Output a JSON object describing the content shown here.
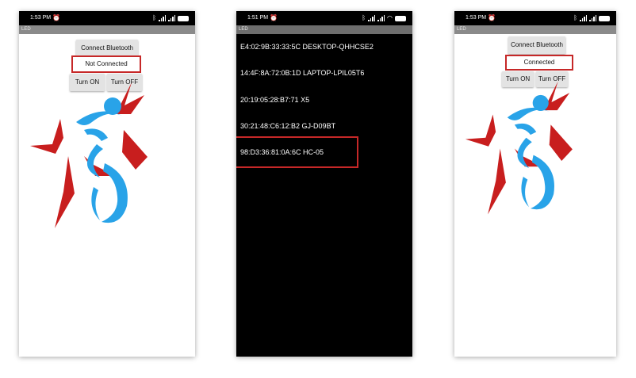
{
  "phones": [
    {
      "status": {
        "time": "1:53 PM"
      },
      "app_title": "LED",
      "buttons": {
        "connect": "Connect Bluetooth",
        "on": "Turn ON",
        "off": "Turn OFF"
      },
      "connection_status": "Not Connected"
    },
    {
      "status": {
        "time": "1:51 PM"
      },
      "app_title": "LED",
      "devices": [
        "E4:02:9B:33:33:5C DESKTOP-QHHCSE2",
        "14:4F:8A:72:0B:1D LAPTOP-LPIL05T6",
        "20:19:05:28:B7:71 X5",
        "30:21:48:C6:12:B2 GJ-D09BT",
        "98:D3:36:81:0A:6C HC-05"
      ]
    },
    {
      "status": {
        "time": "1:53 PM"
      },
      "app_title": "LED",
      "buttons": {
        "connect": "Connect Bluetooth",
        "on": "Turn ON",
        "off": "Turn OFF"
      },
      "connection_status": "Connected"
    }
  ],
  "icons": {
    "alarm": "alarm-clock-icon",
    "bluetooth": "bluetooth-icon",
    "signal": "signal-bars-icon",
    "wifi": "wifi-icon",
    "battery": "battery-icon",
    "logo": "cycling-star-logo"
  },
  "colors": {
    "highlight": "#c62828",
    "logo_red": "#c81e1e",
    "logo_blue": "#29a3e8",
    "list_bg": "#000000"
  }
}
